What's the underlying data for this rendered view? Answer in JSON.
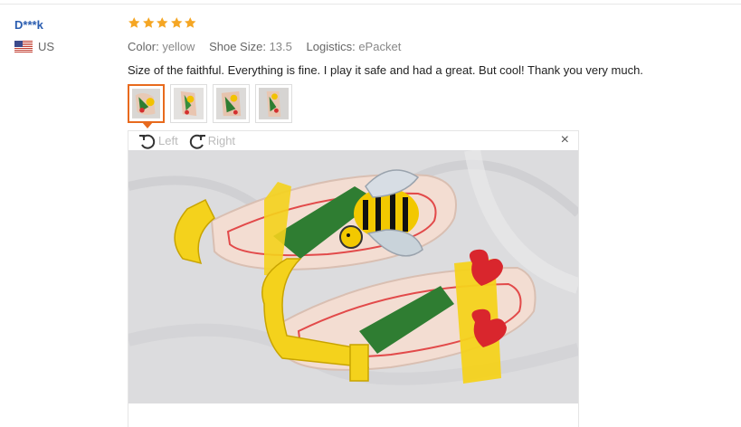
{
  "reviewer": {
    "name": "D***k",
    "country": "US"
  },
  "review": {
    "rating": 5,
    "attributes": [
      {
        "key": "Color:",
        "value": "yellow"
      },
      {
        "key": "Shoe Size:",
        "value": "13.5"
      },
      {
        "key": "Logistics:",
        "value": "ePacket"
      }
    ],
    "feedback": "Size of the faithful. Everything is fine. I play it safe and had a great. But cool! Thank you very much."
  },
  "viewer": {
    "rotate_left_label": "Left",
    "rotate_right_label": "Right",
    "close_glyph": "×"
  },
  "colors": {
    "accent": "#e86a1d",
    "star": "#f5a623",
    "name": "#2a5db0"
  }
}
